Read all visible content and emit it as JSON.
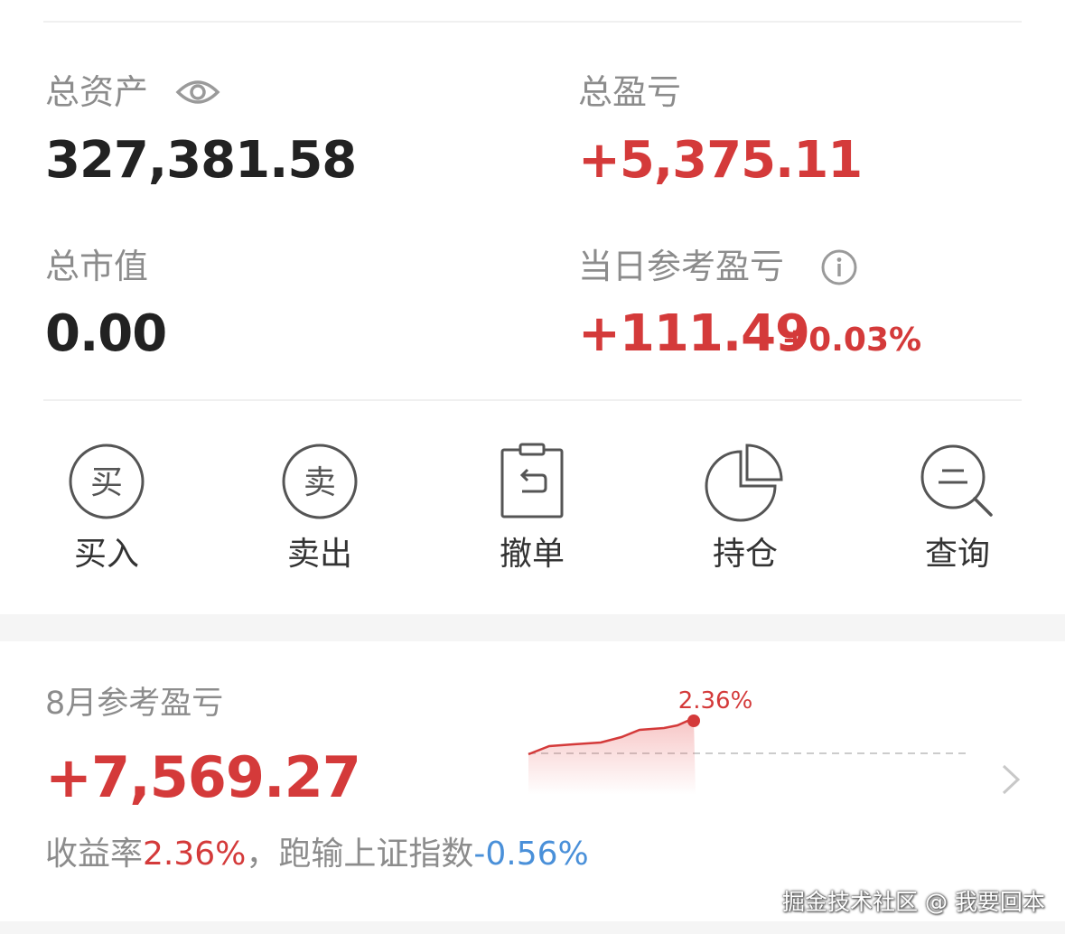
{
  "summary": {
    "total_assets_label": "总资产",
    "total_assets_value": "327,381.58",
    "total_pnl_label": "总盈亏",
    "total_pnl_value": "+5,375.11",
    "market_value_label": "总市值",
    "market_value_value": "0.00",
    "daily_pnl_label": "当日参考盈亏",
    "daily_pnl_value": "+111.49",
    "daily_pnl_percent": "+0.03%"
  },
  "actions": [
    {
      "icon_char": "买",
      "label": "买入"
    },
    {
      "icon_char": "卖",
      "label": "卖出"
    },
    {
      "label": "撤单"
    },
    {
      "label": "持仓"
    },
    {
      "label": "查询"
    }
  ],
  "monthly": {
    "label": "8月参考盈亏",
    "value": "+7,569.27",
    "return_label": "收益率",
    "return_value": "2.36%",
    "compare_label": "，跑输上证指数",
    "compare_value": "-0.56%"
  },
  "chart_data": {
    "type": "area",
    "point_label": "2.36%",
    "colors": {
      "line": "#d43a3a",
      "baseline": "#cccccc"
    }
  },
  "watermark": "掘金技术社区 @ 我要回本",
  "colors": {
    "positive": "#d43a3a",
    "negative": "#4a90d9",
    "label": "#8c8c8c",
    "value": "#222222"
  }
}
